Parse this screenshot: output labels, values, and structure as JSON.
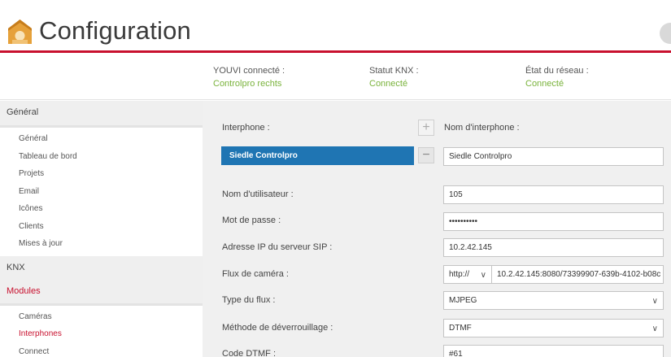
{
  "header": {
    "title": "Configuration",
    "logo_icon": "home-sun-icon",
    "chat_icon": "chat-bubble-icon",
    "accent": "#c8102e"
  },
  "status": [
    {
      "label": "YOUVI connecté :",
      "value": "Controlpro rechts"
    },
    {
      "label": "Statut KNX :",
      "value": "Connecté"
    },
    {
      "label": "État du réseau :",
      "value": "Connecté"
    }
  ],
  "sidebar": {
    "sections": [
      {
        "title": "Général",
        "items": [
          "Général",
          "Tableau de bord",
          "Projets",
          "Email",
          "Icônes",
          "Clients",
          "Mises à jour"
        ]
      },
      {
        "title": "KNX",
        "items": []
      },
      {
        "title": "Modules",
        "items": [
          "Caméras",
          "Interphones",
          "Connect"
        ]
      }
    ],
    "active_section": "Modules",
    "active_item": "Interphones"
  },
  "form": {
    "interphone_label": "Interphone :",
    "interphone_selected": "Siedle Controlpro",
    "add_symbol": "+",
    "remove_symbol": "−",
    "name_label": "Nom d'interphone :",
    "name_value": "Siedle Controlpro",
    "username_label": "Nom d'utilisateur :",
    "username_value": "105",
    "password_label": "Mot de passe :",
    "password_value": "••••••••••",
    "sip_label": "Adresse IP du serveur SIP :",
    "sip_value": "10.2.42.145",
    "camera_label": "Flux de caméra :",
    "camera_protocol": "http://",
    "camera_url": "10.2.42.145:8080/73399907-639b-4102-b08c",
    "stream_type_label": "Type du flux :",
    "stream_type_value": "MJPEG",
    "unlock_label": "Méthode de déverrouillage :",
    "unlock_value": "DTMF",
    "dtmf_label": "Code DTMF :",
    "dtmf_value": "#61"
  }
}
